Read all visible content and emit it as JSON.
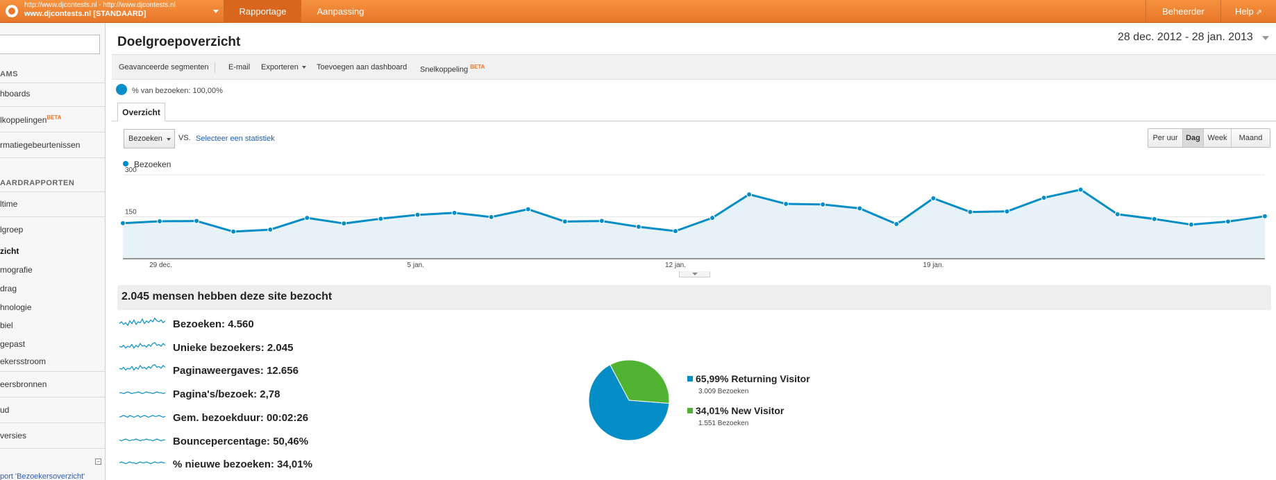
{
  "account": {
    "url": "http://www.djcontests.nl - http://www.djcontests.nl",
    "profile": "www.djcontests.nl [STANDAARD]"
  },
  "nav": {
    "tabs": [
      "Rapportage",
      "Aanpassing"
    ],
    "right": [
      "Beheerder",
      "Help"
    ]
  },
  "sidebar": {
    "sections": [
      {
        "type": "head",
        "label": "AMS"
      },
      {
        "type": "item",
        "label": "hboards"
      },
      {
        "type": "item",
        "label": "lkoppelingen",
        "badge": "BETA"
      },
      {
        "type": "item",
        "label": "rmatiegebeurtenissen"
      },
      {
        "type": "head",
        "label": "AARDRAPPORTEN"
      },
      {
        "type": "item",
        "label": "ltime"
      },
      {
        "type": "sub",
        "label": "lgroep"
      },
      {
        "type": "sub",
        "label": "zicht",
        "bold": true
      },
      {
        "type": "sub",
        "label": "mografie"
      },
      {
        "type": "sub",
        "label": "drag"
      },
      {
        "type": "sub",
        "label": "hnologie"
      },
      {
        "type": "sub",
        "label": "biel"
      },
      {
        "type": "sub",
        "label": "gepast"
      },
      {
        "type": "sub",
        "label": "ekersstroom"
      },
      {
        "type": "item",
        "label": "eersbronnen"
      },
      {
        "type": "item",
        "label": "ud"
      },
      {
        "type": "item",
        "label": "versies"
      }
    ],
    "bottom_link": "port 'Bezoekersoverzicht'"
  },
  "page": {
    "title": "Doelgroepoverzicht",
    "date_range": "28 dec. 2012 - 28 jan. 2013"
  },
  "toolbar": {
    "items": [
      "Geavanceerde segmenten",
      "E-mail",
      "Exporteren",
      "Toevoegen aan dashboard",
      "Snelkoppeling"
    ],
    "beta": "BETA"
  },
  "segment": {
    "label": "% van bezoeken: 100,00%"
  },
  "tabs": {
    "overview": "Overzicht"
  },
  "controls": {
    "metric": "Bezoeken",
    "vs": "VS.",
    "select_stat": "Selecteer een statistiek",
    "periods": [
      "Per uur",
      "Dag",
      "Week",
      "Maand"
    ],
    "active_period": "Dag"
  },
  "colors": {
    "accent": "#058dc7",
    "returning": "#058dc7",
    "new": "#50b432",
    "topbar": "#e8772a"
  },
  "chart_data": {
    "type": "line",
    "series": [
      {
        "name": "Bezoeken",
        "values": [
          127,
          134,
          135,
          97,
          104,
          146,
          126,
          143,
          157,
          164,
          149,
          177,
          133,
          135,
          114,
          99,
          146,
          230,
          196,
          194,
          180,
          124,
          216,
          167,
          169,
          218,
          247,
          159,
          142,
          122,
          133,
          152
        ]
      }
    ],
    "x_tick_labels": [
      {
        "index": 1,
        "label": "29 dec."
      },
      {
        "index": 8,
        "label": "5 jan."
      },
      {
        "index": 15,
        "label": "12 jan."
      },
      {
        "index": 22,
        "label": "19 jan."
      }
    ],
    "y_tick_labels": [
      150,
      300
    ],
    "ylim": [
      0,
      300
    ],
    "grid": true,
    "legend": "top-left"
  },
  "summary": {
    "headline": "2.045 mensen hebben deze site bezocht",
    "stats": [
      {
        "label": "Bezoeken:",
        "value": "4.560"
      },
      {
        "label": "Unieke bezoekers:",
        "value": "2.045"
      },
      {
        "label": "Paginaweergaves:",
        "value": "12.656"
      },
      {
        "label": "Pagina's/bezoek:",
        "value": "2,78"
      },
      {
        "label": "Gem. bezoekduur:",
        "value": "00:02:26"
      },
      {
        "label": "Bouncepercentage:",
        "value": "50,46%"
      },
      {
        "label": "% nieuwe bezoeken:",
        "value": "34,01%"
      }
    ]
  },
  "pie": {
    "type": "pie",
    "slices": [
      {
        "name": "Returning Visitor",
        "percent_label": "65,99%",
        "value": 65.99,
        "sub": "3.009 Bezoeken",
        "color": "#058dc7"
      },
      {
        "name": "New Visitor",
        "percent_label": "34,01%",
        "value": 34.01,
        "sub": "1.551 Bezoeken",
        "color": "#50b432"
      }
    ]
  }
}
